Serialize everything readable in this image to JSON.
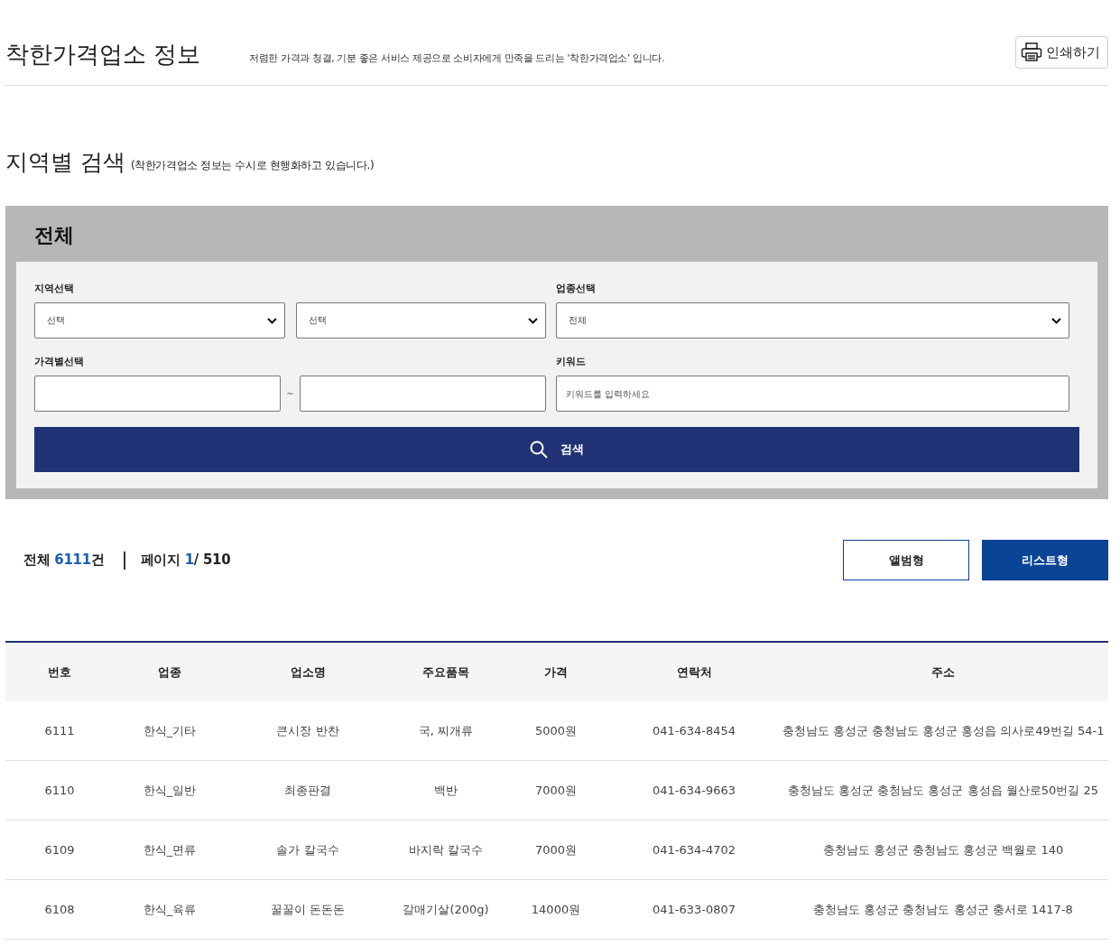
{
  "header": {
    "title": "착한가격업소 정보",
    "description": "저렴한 가격과 청결, 기분 좋은 서비스 제공으로 소비자에게 만족을 드리는 ‘착한가격업소’ 입니다.",
    "print_button": "인쇄하기"
  },
  "section": {
    "title": "지역별 검색",
    "note": "(착한가격업소 정보는 수시로 현행화하고 있습니다.)"
  },
  "search_panel": {
    "title": "전체",
    "region": {
      "label": "지역선택",
      "selects": [
        "선택",
        "선택"
      ]
    },
    "category": {
      "label": "업종선택",
      "select": "전체"
    },
    "price": {
      "label": "가격별선택",
      "separator": "~"
    },
    "keyword": {
      "label": "키워드",
      "placeholder": "키워드를 입력하세요"
    },
    "search_button": "검색"
  },
  "summary": {
    "count_label": "전체",
    "count_value": "6111",
    "count_unit": "건",
    "page_label": "페이지",
    "page_current": "1",
    "page_total": "/ 510"
  },
  "view_buttons": [
    {
      "label": "앨범형",
      "selected": false
    },
    {
      "label": "리스트형",
      "selected": true
    }
  ],
  "table": {
    "columns": [
      "번호",
      "업종",
      "업소명",
      "주요품목",
      "가격",
      "연락처",
      "주소"
    ],
    "rows": [
      [
        "6111",
        "한식_기타",
        "큰시장 반찬",
        "국, 찌개류",
        "5000원",
        "041-634-8454",
        "충청남도 홍성군 충청남도 홍성군 홍성읍 의사로49번길 54-1"
      ],
      [
        "6110",
        "한식_일반",
        "최종판결",
        "백반",
        "7000원",
        "041-634-9663",
        "충청남도 홍성군 충청남도 홍성군 홍성읍 월산로50번길 25"
      ],
      [
        "6109",
        "한식_면류",
        "솔가 칼국수",
        "바지락 칼국수",
        "7000원",
        "041-634-4702",
        "충청남도 홍성군 충청남도 홍성군 백월로 140"
      ],
      [
        "6108",
        "한식_육류",
        "꿀꿀이 돈돈돈",
        "갈매기살(200g)",
        "14000원",
        "041-633-0807",
        "충청남도 홍성군 충청남도 홍성군 충서로 1417-8"
      ]
    ]
  }
}
